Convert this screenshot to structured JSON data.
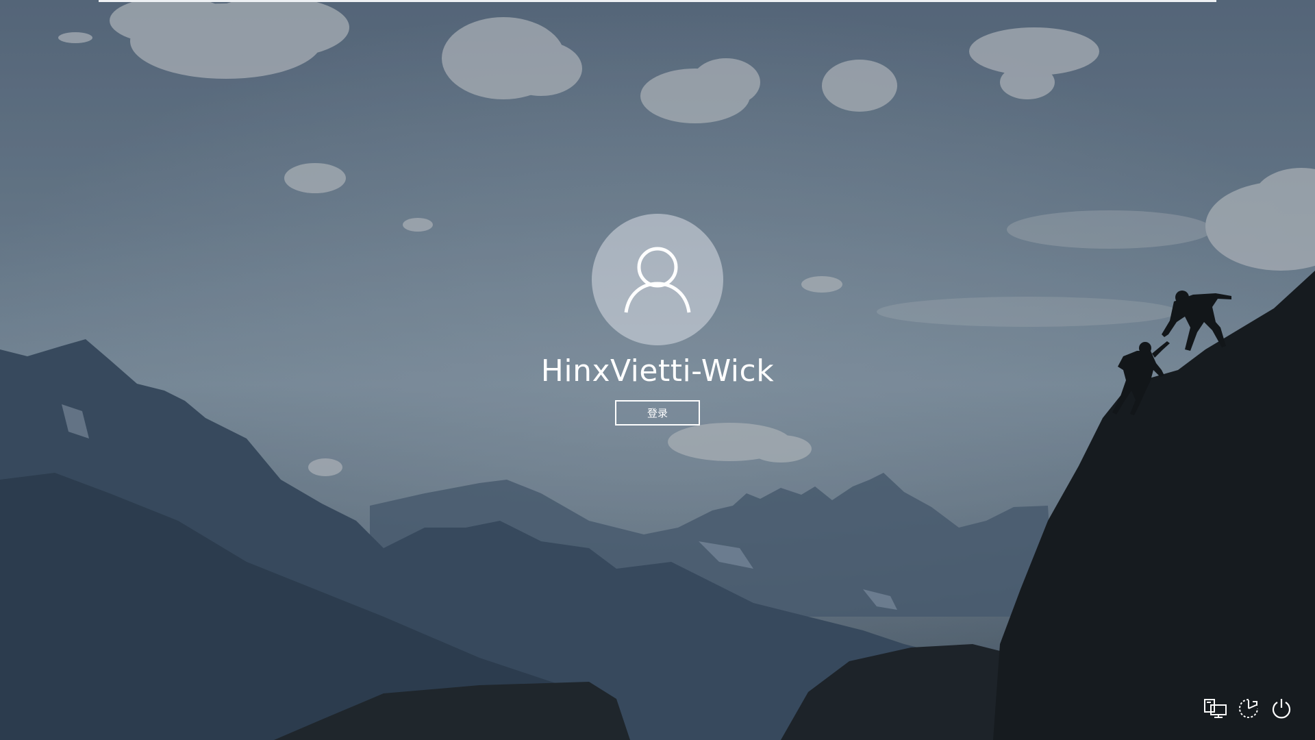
{
  "login": {
    "user_name": "HinxVietti-Wick",
    "signin_label": "登录"
  },
  "system_buttons": [
    {
      "name": "network",
      "icon": "network-icon"
    },
    {
      "name": "ease-of-access",
      "icon": "ease-of-access-icon"
    },
    {
      "name": "power",
      "icon": "power-icon"
    }
  ],
  "colors": {
    "sky": "#6f8294",
    "mountains": "#34485c",
    "foreground_rock": "#15191d",
    "text": "#ffffff"
  }
}
